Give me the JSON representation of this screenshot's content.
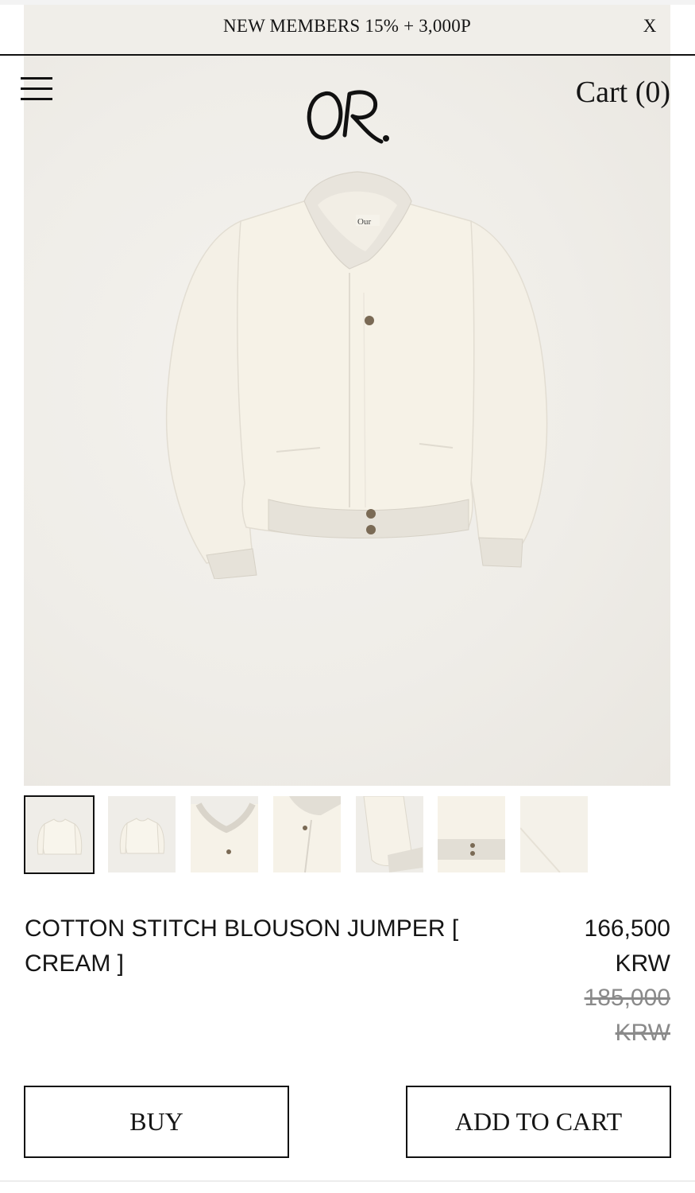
{
  "promo": {
    "text": "NEW MEMBERS 15% + 3,000P",
    "close_label": "X"
  },
  "header": {
    "menu_icon": "hamburger-menu-icon",
    "logo_text": "OR.",
    "cart_label": "Cart (0)"
  },
  "product_image": {
    "brand_tag": "Our"
  },
  "thumbnails": {
    "count": 7,
    "selected_index": 0
  },
  "product": {
    "title": "COTTON STITCH BLOUSON JUMPER [ CREAM ]",
    "price_line1": "166,500",
    "price_line2": "KRW",
    "original_price_line1": "185,000",
    "original_price_line2": "KRW"
  },
  "actions": {
    "buy_label": "BUY",
    "add_to_cart_label": "ADD TO CART"
  },
  "colors": {
    "background": "#f0eee9",
    "text": "#151515",
    "jacket": "#f6f2e7",
    "rib": "#e4e0d8"
  }
}
